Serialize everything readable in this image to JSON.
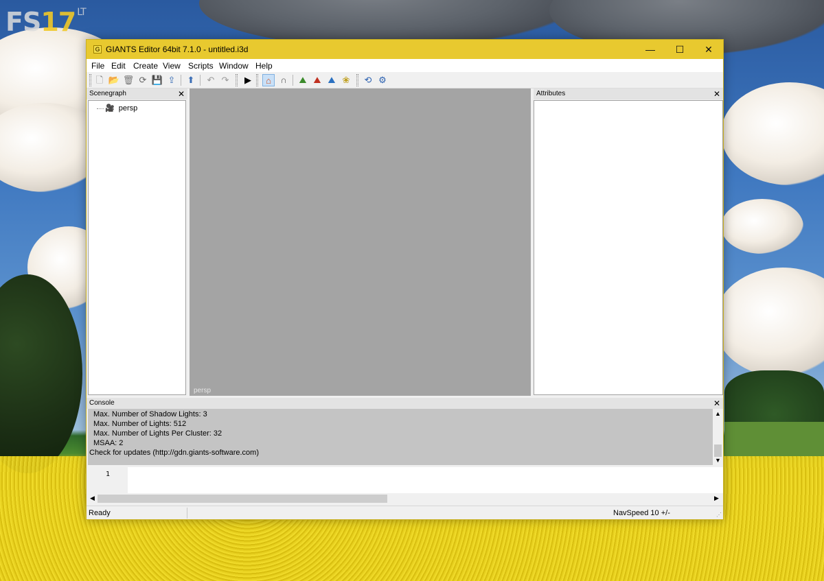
{
  "watermark": {
    "brand": "FS",
    "number": "17",
    "suffix": "LT"
  },
  "window": {
    "title": "GIANTS Editor 64bit 7.1.0 - untitled.i3d",
    "app_icon": "giants-logo-icon",
    "controls": {
      "minimize": "—",
      "maximize": "☐",
      "close": "✕"
    }
  },
  "menubar": {
    "items": [
      "File",
      "Edit",
      "Create",
      "View",
      "Scripts",
      "Window",
      "Help"
    ]
  },
  "toolbar": {
    "icons": [
      "new-file-icon",
      "open-folder-icon",
      "delete-icon",
      "refresh-icon",
      "save-icon",
      "export-icon",
      "import-icon",
      "undo-icon",
      "redo-icon",
      "play-icon",
      "select-tool-icon",
      "magnet-icon",
      "terrain-paint-icon",
      "terrain-sculpt-icon",
      "foliage-paint-icon",
      "foliage-icon",
      "rotate-icon",
      "settings-icon"
    ]
  },
  "scenegraph": {
    "title": "Scenegraph",
    "close": "✕",
    "nodes": [
      {
        "label": "persp",
        "icon": "camera-icon"
      }
    ]
  },
  "viewport": {
    "label": "persp"
  },
  "attributes": {
    "title": "Attributes",
    "close": "✕"
  },
  "console": {
    "title": "Console",
    "close": "✕",
    "lines": [
      "Max. Number of Shadow Lights: 3",
      "Max. Number of Lights: 512",
      "Max. Number of Lights Per Cluster: 32",
      "MSAA: 2",
      "Check for updates (http://gdn.giants-software.com)"
    ],
    "editor_line_number": "1"
  },
  "statusbar": {
    "left": "Ready",
    "right": "NavSpeed 10 +/-"
  }
}
